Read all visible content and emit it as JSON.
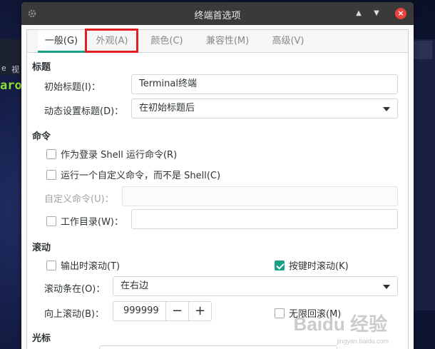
{
  "window": {
    "title": "终端首选项"
  },
  "tabs": [
    {
      "label": "一般(G)",
      "active": true
    },
    {
      "label": "外观(A)",
      "active": false
    },
    {
      "label": "颜色(C)",
      "active": false
    },
    {
      "label": "兼容性(M)",
      "active": false
    },
    {
      "label": "高级(V)",
      "active": false
    }
  ],
  "title_section": {
    "heading": "标题",
    "initial_title_label": "初始标题(I)：",
    "initial_title_value": "Terminal终端",
    "dynamic_title_label": "动态设置标题(D)：",
    "dynamic_title_value": "在初始标题后"
  },
  "command_section": {
    "heading": "命令",
    "login_shell_label": "作为登录 Shell 运行命令(R)",
    "login_shell_checked": false,
    "custom_command_check_label": "运行一个自定义命令，而不是 Shell(C)",
    "custom_command_checked": false,
    "custom_command_label": "自定义命令(U)：",
    "custom_command_value": "",
    "working_dir_label": "工作目录(W)：",
    "working_dir_checked": false,
    "working_dir_value": ""
  },
  "scroll_section": {
    "heading": "滚动",
    "scroll_on_output_label": "输出时滚动(T)",
    "scroll_on_output_checked": false,
    "scroll_on_key_label": "按键时滚动(K)",
    "scroll_on_key_checked": true,
    "scrollbar_label": "滚动条在(O)：",
    "scrollbar_value": "在右边",
    "scrollback_label": "向上滚动(B)：",
    "scrollback_value": "999999",
    "unlimited_label": "无限回滚(M)",
    "unlimited_checked": false
  },
  "cursor_section": {
    "heading": "光标"
  },
  "background": {
    "term_text": "aro",
    "menu_frag_1": "e",
    "menu_frag_2": "视"
  },
  "watermark": {
    "text": "Baidu 经验",
    "sub": "jingyan.baidu.com"
  },
  "colors": {
    "accent": "#16a085",
    "highlight": "#e01e24",
    "close": "#e8423f"
  }
}
